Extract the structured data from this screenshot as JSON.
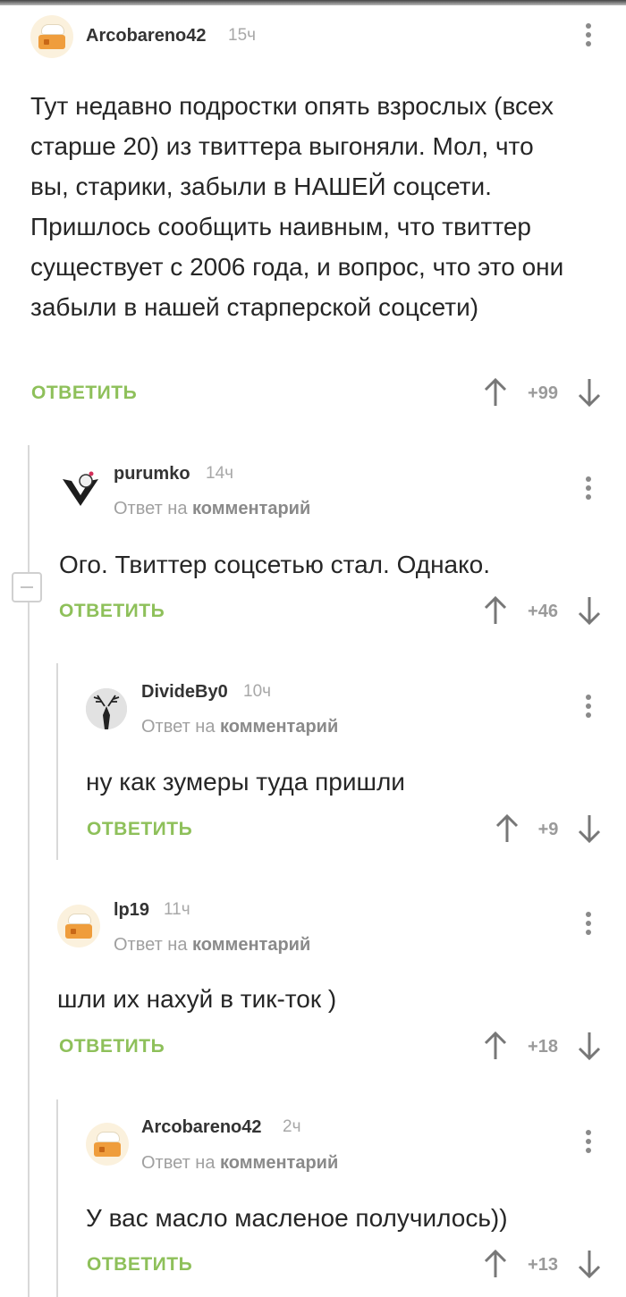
{
  "comments": [
    {
      "author": "Arcobareno42",
      "time": "15ч",
      "reply_to": "",
      "reply_to_target": "",
      "text": "Тут недавно подростки опять взрослых (всех старше 20) из твиттера выгоняли. Мол, что вы, старики, забыли в НАШЕЙ соцсети. Пришлось сообщить наивным, что твиттер существует с 2006 года, и вопрос, что это они забыли в нашей старперской соцсети)",
      "reply_label": "ОТВЕТИТЬ",
      "score": "+99",
      "avatar": "chef-hat-avatar"
    },
    {
      "author": "purumko",
      "time": "14ч",
      "reply_to": "Ответ на",
      "reply_to_target": "комментарий",
      "text": "Ого. Твиттер соцсетью стал. Однако.",
      "reply_label": "ОТВЕТИТЬ",
      "score": "+46",
      "avatar": "logo-avatar"
    },
    {
      "author": "DivideBy0",
      "time": "10ч",
      "reply_to": "Ответ на",
      "reply_to_target": "комментарий",
      "text": "ну как зумеры туда пришли",
      "reply_label": "ОТВЕТИТЬ",
      "score": "+9",
      "avatar": "deer-avatar"
    },
    {
      "author": "lp19",
      "time": "11ч",
      "reply_to": "Ответ на",
      "reply_to_target": "комментарий",
      "text": "шли их нахуй в тик-ток )",
      "reply_label": "ОТВЕТИТЬ",
      "score": "+18",
      "avatar": "chef-hat-avatar"
    },
    {
      "author": "Arcobareno42",
      "time": "2ч",
      "reply_to": "Ответ на",
      "reply_to_target": "комментарий",
      "text": "У вас масло масленое получилось))",
      "reply_label": "ОТВЕТИТЬ",
      "score": "+13",
      "avatar": "chef-hat-avatar"
    }
  ],
  "colors": {
    "accent_green": "#8ec05a",
    "text": "#262626",
    "muted": "#a0a0a0",
    "thread_line": "#d9d9d9"
  }
}
